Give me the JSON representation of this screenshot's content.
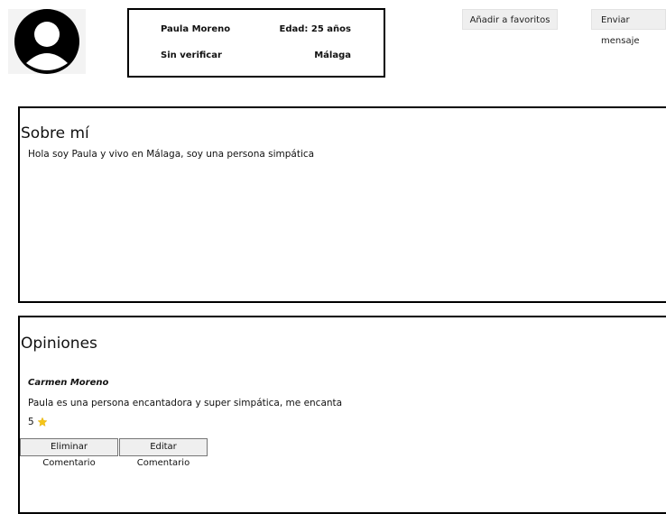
{
  "profile": {
    "name": "Paula Moreno",
    "age": "Edad: 25 años",
    "verification": "Sin verificar",
    "city": "Málaga"
  },
  "actions": {
    "favorite_label": "Añadir a favoritos",
    "message_label": "Enviar mensaje"
  },
  "about": {
    "title": "Sobre mí",
    "text": "Hola soy Paula y vivo en Málaga, soy una persona simpática"
  },
  "opinions": {
    "title": "Opiniones",
    "items": [
      {
        "author": "Carmen Moreno",
        "text": "Paula es una persona encantadora y super simpática, me encanta",
        "rating": "5",
        "rating_icon": "star-icon",
        "delete_label": "Eliminar Comentario",
        "edit_label": "Editar Comentario"
      }
    ]
  },
  "colors": {
    "star": "#f5c518",
    "border": "#000000",
    "button_bg": "#efefef"
  }
}
